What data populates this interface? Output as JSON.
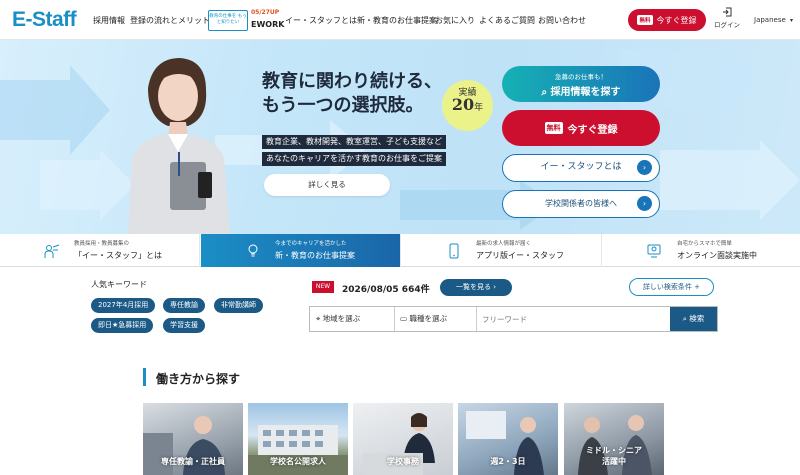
{
  "header": {
    "logo": "E-Staff",
    "nav": [
      "採用情報",
      "登録の流れとメリット",
      "イー・スタッフとは",
      "新・教育のお仕事提案",
      "お気に入り",
      "よくあるご質問",
      "お問い合わせ"
    ],
    "eework_box": "教育の仕事を もっと知りたい",
    "eework_date": "05/27UP",
    "eework_name": "EWORK",
    "register_tag": "無料",
    "register_label": "今すぐ登録",
    "login_label": "ログイン",
    "language": "Japanese"
  },
  "hero": {
    "title_line1": "教育に関わり続ける、",
    "title_line2": "もう一つの選択肢。",
    "badge_top": "実績",
    "badge_num": "20",
    "badge_unit": "年",
    "strip1": "教育企業、教材開発、教室運営、子ども支援など",
    "strip2": "あなたのキャリアを活かす教育のお仕事をご提案",
    "more_button": "詳しく見る",
    "cta_jobs_sub": "急募のお仕事も！",
    "cta_jobs_label": "採用情報を探す",
    "cta_register_tag": "無料",
    "cta_register_label": "今すぐ登録",
    "cta_about_label": "イー・スタッフとは",
    "cta_school_label": "学校関係者の皆様へ"
  },
  "features": [
    {
      "small": "教員採用・教員募集の",
      "large": "「イー・スタッフ」とは"
    },
    {
      "small": "今までのキャリアを活かした",
      "large": "新・教育のお仕事提案"
    },
    {
      "small": "最新の求人情報が届く",
      "large": "アプリ版イー・スタッフ"
    },
    {
      "small": "自宅からスマホで簡単",
      "large": "オンライン面談実施中"
    }
  ],
  "keywords": {
    "title": "人気キーワード",
    "items": [
      "2027年4月採用",
      "専任教諭",
      "非常勤講師",
      "即日★急募採用",
      "学習支援"
    ]
  },
  "search": {
    "new_tag": "NEW",
    "count_text": "2026/08/05 664件",
    "list_button": "一覧を見る",
    "advanced_button": "詳しい検索条件",
    "area_label": "地域を選ぶ",
    "job_label": "職種を選ぶ",
    "freeword_placeholder": "フリーワード",
    "search_button": "検索"
  },
  "section": {
    "title": "働き方から探す",
    "cards": [
      "専任教諭・正社員",
      "学校名公開求人",
      "学校事務",
      "週2・3日",
      "ミドル・シニア 活躍中"
    ]
  },
  "colors": {
    "primary": "#1a8fc4",
    "navy": "#1b5a86",
    "red": "#cc0f2f"
  }
}
